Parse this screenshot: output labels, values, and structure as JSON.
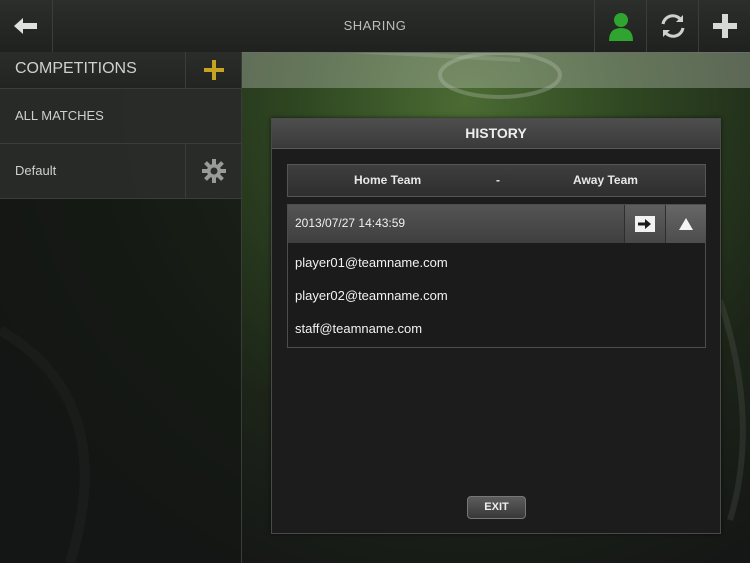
{
  "topbar": {
    "title": "SHARING",
    "back_icon": "back-arrow-icon",
    "user_icon": "user-icon",
    "sync_icon": "sync-icon",
    "add_icon": "plus-icon",
    "user_icon_color": "#2fa52f"
  },
  "sidebar": {
    "header_label": "COMPETITIONS",
    "add_icon_color": "#c9a320",
    "items": [
      {
        "label": "ALL MATCHES"
      },
      {
        "label": "Default",
        "icon": "gear-icon"
      }
    ]
  },
  "dialog": {
    "title": "HISTORY",
    "match": {
      "home": "Home Team",
      "separator": "-",
      "away": "Away Team"
    },
    "share": {
      "datetime": "2013/07/27 14:43:59",
      "send_icon": "arrow-right-icon",
      "collapse_icon": "triangle-up-icon",
      "recipients": [
        "player01@teamname.com",
        "player02@teamname.com",
        "staff@teamname.com"
      ]
    },
    "exit_label": "EXIT"
  }
}
